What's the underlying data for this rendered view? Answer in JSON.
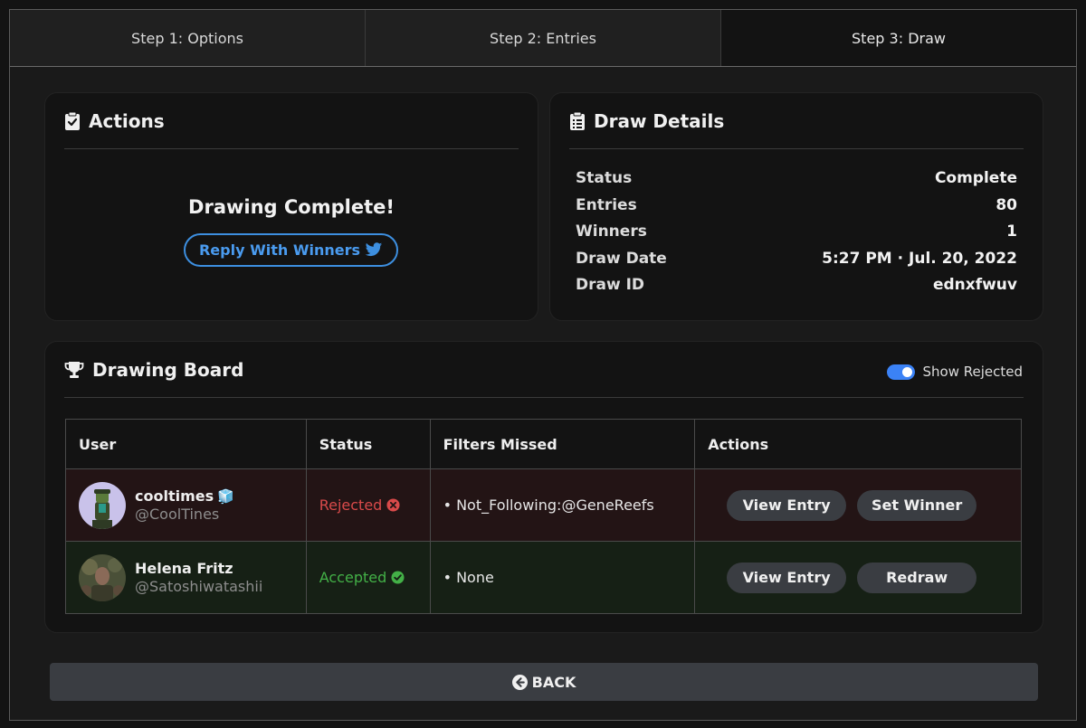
{
  "tabs": [
    {
      "label": "Step 1: Options",
      "active": false
    },
    {
      "label": "Step 2: Entries",
      "active": false
    },
    {
      "label": "Step 3: Draw",
      "active": true
    }
  ],
  "actions_card": {
    "title": "Actions",
    "icon": "clipboard-check-icon",
    "message": "Drawing Complete!",
    "reply_button": "Reply With Winners",
    "reply_icon": "twitter-bird-icon"
  },
  "details_card": {
    "title": "Draw Details",
    "icon": "clipboard-list-icon",
    "rows": [
      {
        "key": "Status",
        "value": "Complete"
      },
      {
        "key": "Entries",
        "value": "80"
      },
      {
        "key": "Winners",
        "value": "1"
      },
      {
        "key": "Draw Date",
        "value": "5:27 PM · Jul. 20, 2022"
      },
      {
        "key": "Draw ID",
        "value": "ednxfwuv"
      }
    ]
  },
  "board": {
    "title": "Drawing Board",
    "icon": "trophy-icon",
    "toggle_label": "Show Rejected",
    "toggle_on": true,
    "columns": [
      "User",
      "Status",
      "Filters Missed",
      "Actions"
    ],
    "rows": [
      {
        "name": "cooltimes",
        "name_badge": "🧊",
        "handle": "@CoolTines",
        "status": "Rejected",
        "status_icon": "x-circle-icon",
        "filters": "• Not_Following:@GeneReefs",
        "actions": [
          "View Entry",
          "Set Winner"
        ]
      },
      {
        "name": "Helena Fritz",
        "handle": "@Satoshiwatashii",
        "status": "Accepted",
        "status_icon": "check-circle-icon",
        "filters": "• None",
        "actions": [
          "View Entry",
          "Redraw"
        ]
      }
    ]
  },
  "back_button": "BACK",
  "colors": {
    "accent": "#3b82f6",
    "rejected": "#d94a4a",
    "accepted": "#43b047"
  }
}
